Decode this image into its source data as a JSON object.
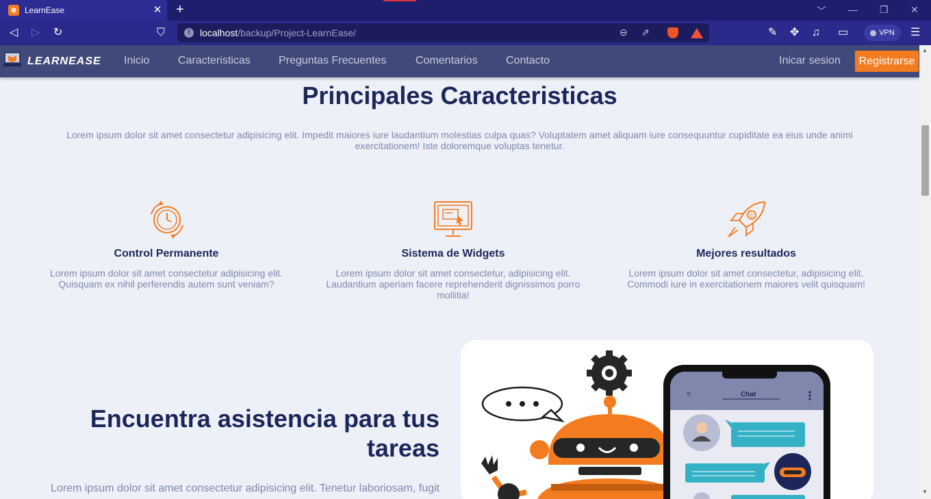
{
  "browser": {
    "tab_title": "LearnEase",
    "tab_close": "✕",
    "new_tab": "+",
    "url_host": "localhost",
    "url_path": "/backup/Project-LearnEase/",
    "vpn_label": "VPN"
  },
  "header": {
    "logo_text": "LEARNEASE",
    "nav": [
      "Inicio",
      "Caracteristicas",
      "Preguntas Frecuentes",
      "Comentarios",
      "Contacto"
    ],
    "login": "Inicar sesion",
    "register": "Registrarse"
  },
  "features": {
    "title": "Principales Caracteristicas",
    "intro": "Lorem ipsum dolor sit amet consectetur adipisicing elit. Impedit maiores iure laudantium molestias culpa quas? Voluptatem amet aliquam iure consequuntur cupiditate ea eius unde animi exercitationem! Iste doloremque voluptas tenetur.",
    "items": [
      {
        "title": "Control Permanente",
        "desc": "Lorem ipsum dolor sit amet consectetur adipisicing elit. Quisquam ex nihil perferendis autem sunt veniam?",
        "icon": "clock-icon"
      },
      {
        "title": "Sistema de Widgets",
        "desc": "Lorem ipsum dolor sit amet consectetur, adipisicing elit. Laudantium aperiam facere reprehenderit dignissimos porro mollitia!",
        "icon": "monitor-widget-icon"
      },
      {
        "title": "Mejores resultados",
        "desc": "Lorem ipsum dolor sit amet consectetur, adipisicing elit. Commodi iure in exercitationem maiores velit quisquam!",
        "icon": "rocket-icon"
      }
    ]
  },
  "assist": {
    "title": "Encuentra asistencia para tus tareas",
    "desc": "Lorem ipsum dolor sit amet consectetur adipisicing elit. Tenetur laboriosam, fugit",
    "chat_header": "Chat",
    "chat_back": "<"
  },
  "colors": {
    "accent": "#f47c20",
    "navy": "#1c2659",
    "muted": "#7f87ad",
    "header_bg": "#404a7a"
  }
}
